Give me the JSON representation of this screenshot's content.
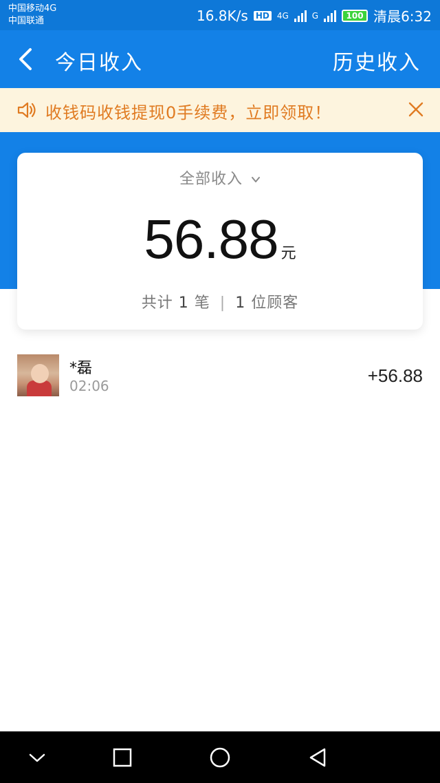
{
  "status_bar": {
    "carrier1": "中国移动4G",
    "carrier2": "中国联通",
    "speed": "16.8K/s",
    "hd": "HD",
    "net1": "4G",
    "net2": "G",
    "battery": "100",
    "time": "清晨6:32"
  },
  "header": {
    "title": "今日收入",
    "history_label": "历史收入"
  },
  "notice": {
    "text": "收钱码收钱提现0手续费，立即领取！"
  },
  "summary_card": {
    "filter_label": "全部收入",
    "amount": "56.88",
    "unit": "元",
    "count_prefix": "共计",
    "count": "1",
    "count_unit": "笔",
    "customers": "1",
    "customers_unit": "位顾客"
  },
  "transactions": [
    {
      "name": "*磊",
      "time": "02:06",
      "amount": "+56.88"
    }
  ],
  "colors": {
    "primary": "#1381e7",
    "status_bar": "#0e78d8",
    "notice_bg": "#fdf4de",
    "notice_text": "#e07b22"
  },
  "icons": {
    "back": "chevron-left-icon",
    "speaker": "speaker-icon",
    "close": "close-icon",
    "filter": "chevron-down-icon",
    "nav_back": "triangle-back-icon",
    "nav_home": "circle-home-icon",
    "nav_recent": "square-recent-icon",
    "nav_down": "chevron-down-icon"
  }
}
